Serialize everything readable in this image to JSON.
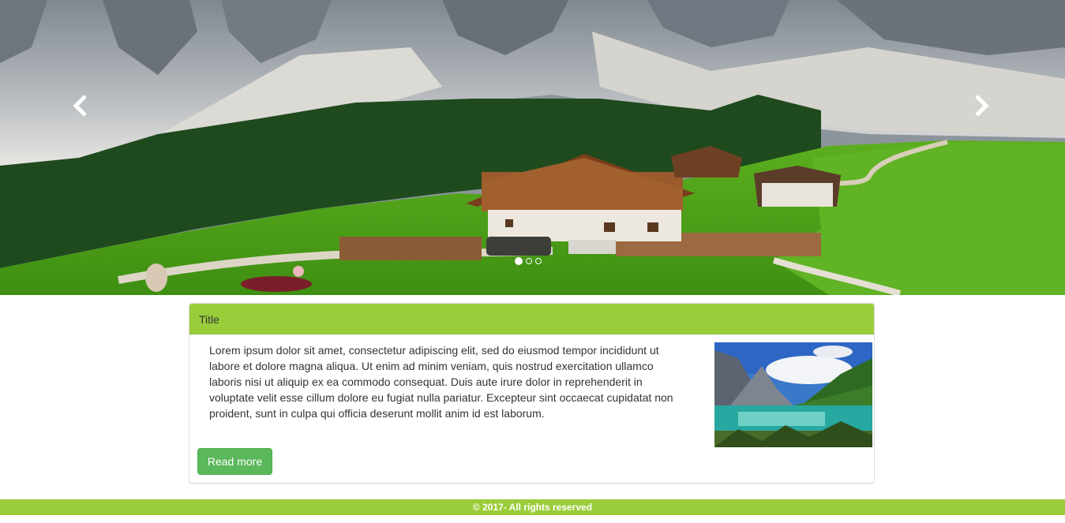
{
  "carousel": {
    "slide_image": "mountain-chalet-meadow-photo",
    "prev_icon": "chevron-left-icon",
    "next_icon": "chevron-right-icon",
    "indicators": [
      {
        "active": true
      },
      {
        "active": false
      },
      {
        "active": false
      }
    ]
  },
  "panel": {
    "title": "Title",
    "body": "Lorem ipsum dolor sit amet, consectetur adipiscing elit, sed do eiusmod tempor incididunt ut labore et dolore magna aliqua. Ut enim ad minim veniam, quis nostrud exercitation ullamco laboris nisi ut aliquip ex ea commodo consequat. Duis aute irure dolor in reprehenderit in voluptate velit esse cillum dolore eu fugiat nulla pariatur. Excepteur sint occaecat cupidatat non proident, sunt in culpa qui officia deserunt mollit anim id est laborum.",
    "thumbnail": "mountain-lake-photo",
    "button_label": "Read more"
  },
  "footer": {
    "text": "© 2017- All rights reserved"
  },
  "colors": {
    "accent_green": "#9acd3a",
    "button_green": "#5cb85c"
  }
}
